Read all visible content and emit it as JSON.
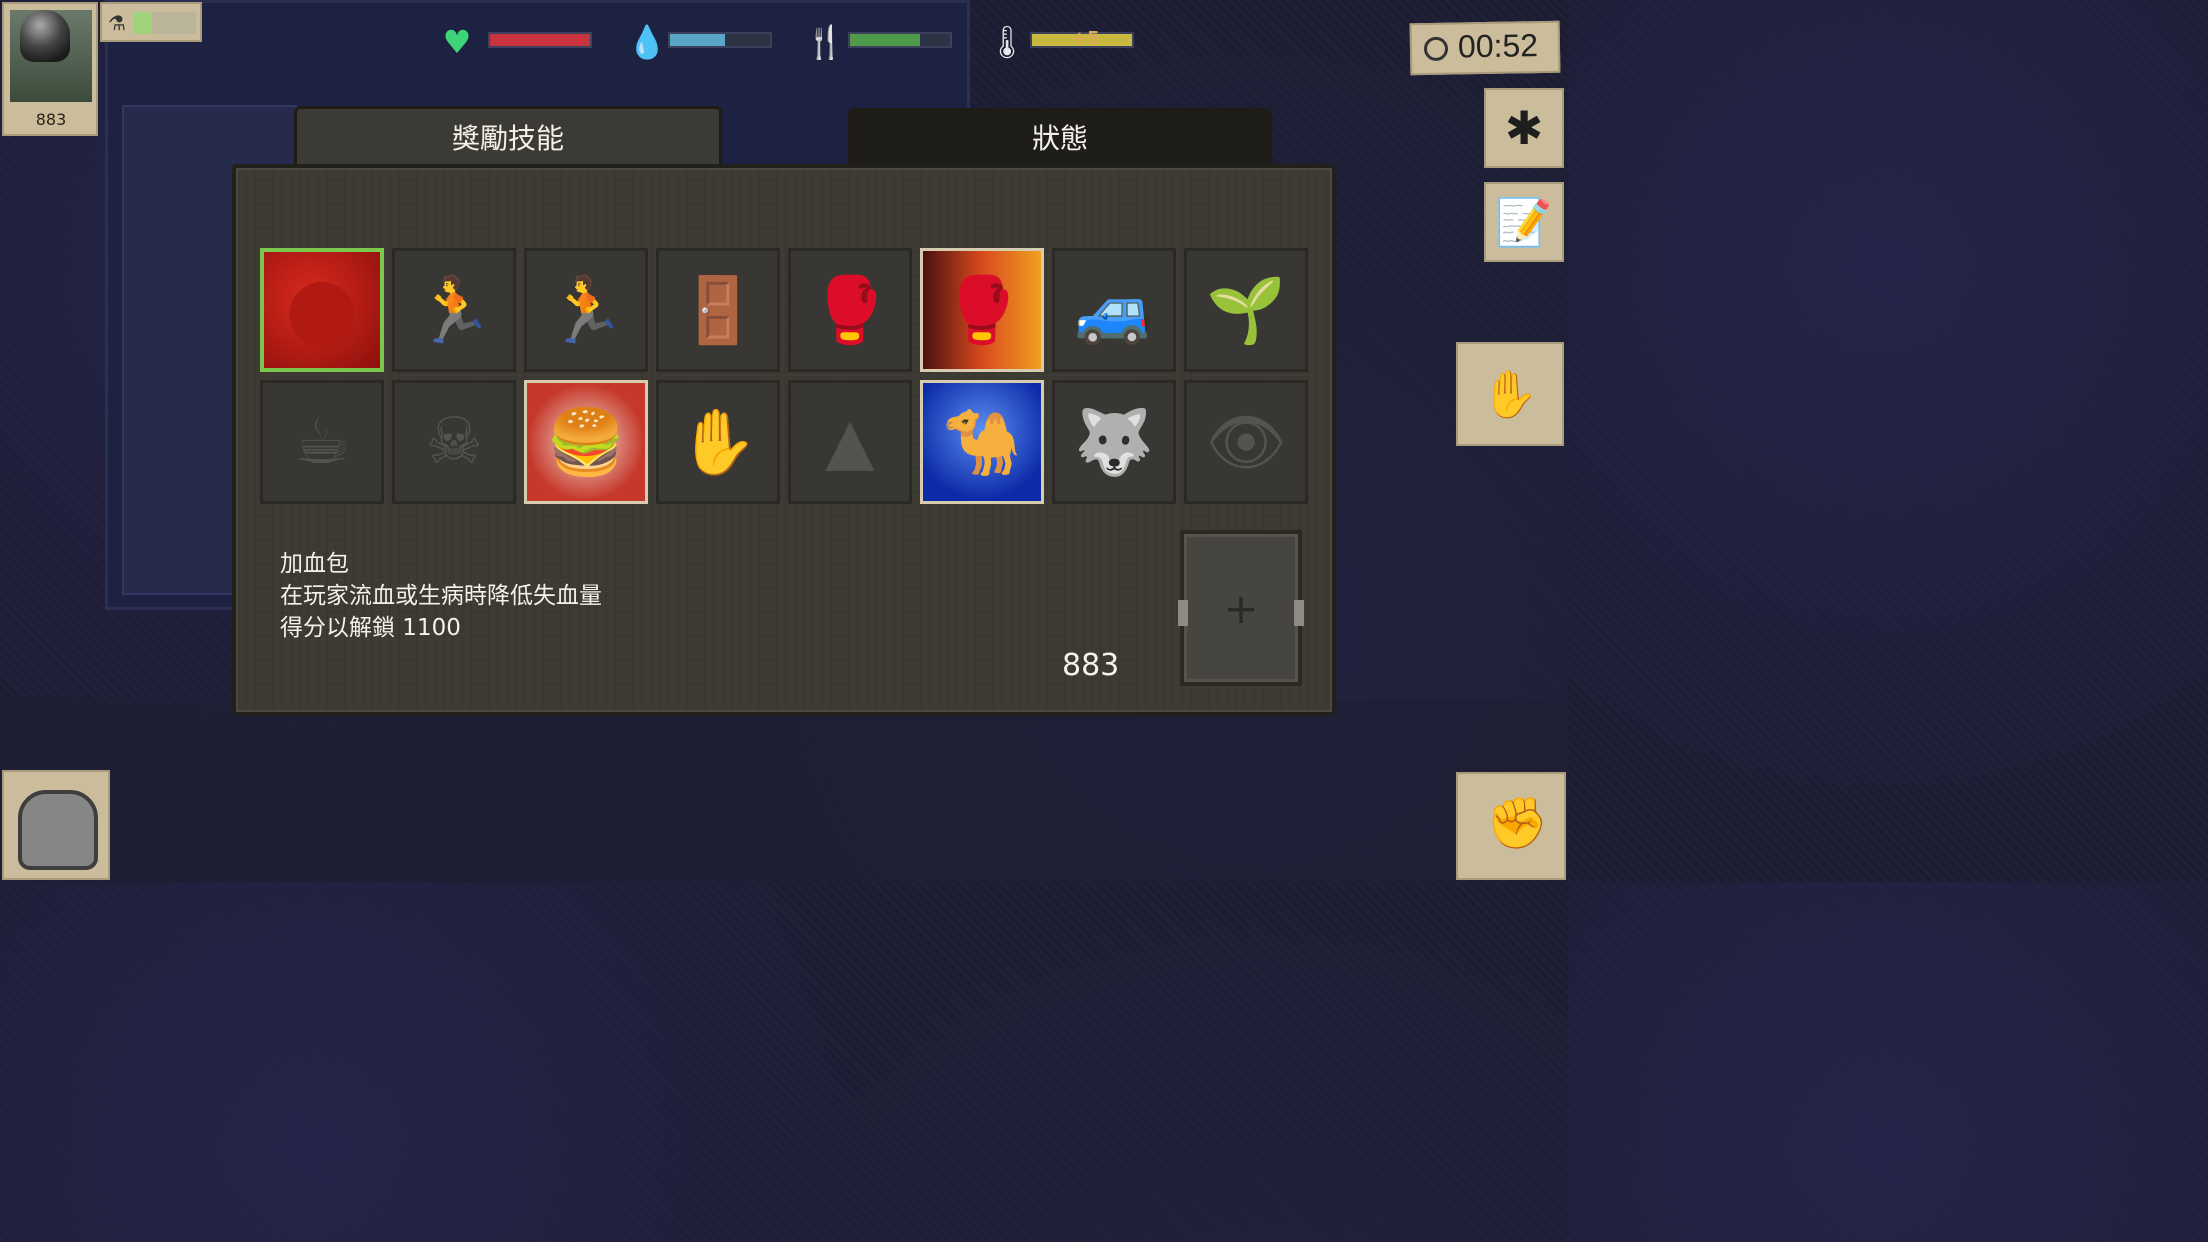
{
  "hud": {
    "player_score": "883",
    "timer": "00:52",
    "stats": [
      {
        "name": "health",
        "icon": "heart-icon",
        "fill": 1.0,
        "color": "#c8333f"
      },
      {
        "name": "water",
        "icon": "water-drop-icon",
        "fill": 0.55,
        "color": "#5aa6c4"
      },
      {
        "name": "food",
        "icon": "fork-knife-icon",
        "fill": 0.7,
        "color": "#4f9a4a"
      },
      {
        "name": "temperature",
        "icon": "thermometer-icon",
        "fill": 1.0,
        "color": "#c9b93e",
        "value": "+5"
      }
    ]
  },
  "tabs": {
    "rewards": "獎勵技能",
    "status": "狀態"
  },
  "skills": {
    "row1": [
      {
        "name": "blood-cells",
        "state": "selected"
      },
      {
        "name": "running-people",
        "state": "locked"
      },
      {
        "name": "sprinter",
        "state": "locked"
      },
      {
        "name": "breaking-door",
        "state": "locked"
      },
      {
        "name": "fighter-smoke",
        "state": "locked"
      },
      {
        "name": "boxer",
        "state": "unlocked"
      },
      {
        "name": "truck",
        "state": "locked"
      },
      {
        "name": "plant",
        "state": "locked"
      }
    ],
    "row2": [
      {
        "name": "coffee-mug",
        "state": "locked"
      },
      {
        "name": "skull",
        "state": "locked"
      },
      {
        "name": "burgers",
        "state": "unlocked"
      },
      {
        "name": "gloved-hand",
        "state": "locked"
      },
      {
        "name": "spikes",
        "state": "locked"
      },
      {
        "name": "camel",
        "state": "unlocked"
      },
      {
        "name": "wolf",
        "state": "locked"
      },
      {
        "name": "eye",
        "state": "locked"
      }
    ]
  },
  "selected_skill": {
    "title": "加血包",
    "description": "在玩家流血或生病時降低失血量",
    "unlock": "得分以解鎖  1100"
  },
  "available_points": "883",
  "add_slot_symbol": "+"
}
